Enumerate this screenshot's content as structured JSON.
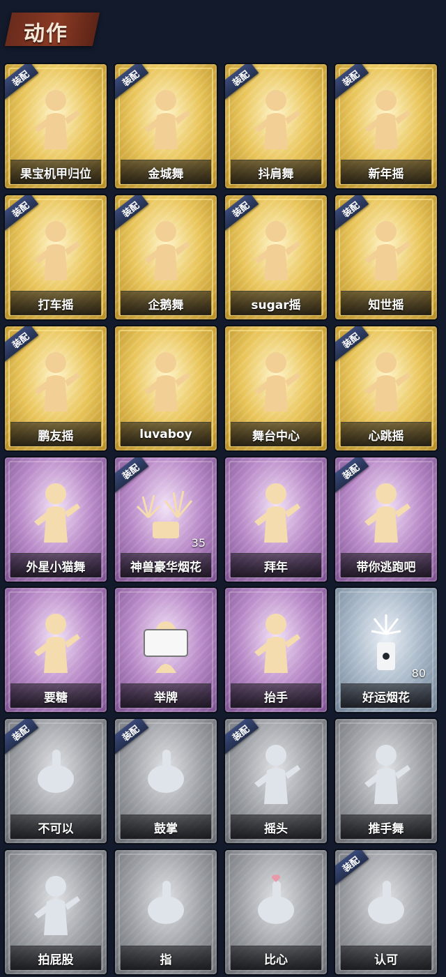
{
  "header": {
    "title": "动作"
  },
  "equip_label": "装配",
  "cards": [
    {
      "label": "果宝机甲归位",
      "tier": "gold",
      "equipped": true,
      "icon": "dancer-icon"
    },
    {
      "label": "金城舞",
      "tier": "gold",
      "equipped": true,
      "icon": "dancer-icon"
    },
    {
      "label": "抖肩舞",
      "tier": "gold",
      "equipped": true,
      "icon": "dancer-icon"
    },
    {
      "label": "新年摇",
      "tier": "gold",
      "equipped": true,
      "icon": "dancer-icon"
    },
    {
      "label": "打车摇",
      "tier": "gold",
      "equipped": true,
      "icon": "dancer-icon"
    },
    {
      "label": "企鹅舞",
      "tier": "gold",
      "equipped": true,
      "icon": "dancer-icon"
    },
    {
      "label": "sugar摇",
      "tier": "gold",
      "equipped": true,
      "icon": "dancer-icon"
    },
    {
      "label": "知世摇",
      "tier": "gold",
      "equipped": true,
      "icon": "dancer-icon"
    },
    {
      "label": "鹏友摇",
      "tier": "gold",
      "equipped": true,
      "icon": "dancer-icon"
    },
    {
      "label": "luvaboy",
      "tier": "gold",
      "equipped": false,
      "icon": "dancer-icon"
    },
    {
      "label": "舞台中心",
      "tier": "gold",
      "equipped": false,
      "icon": "dancer-icon"
    },
    {
      "label": "心跳摇",
      "tier": "gold",
      "equipped": true,
      "icon": "dancer-icon"
    },
    {
      "label": "外星小猫舞",
      "tier": "purple",
      "equipped": false,
      "icon": "dancer-icon"
    },
    {
      "label": "神兽豪华烟花",
      "tier": "purple",
      "equipped": true,
      "icon": "fireworks-icon",
      "count": "35"
    },
    {
      "label": "拜年",
      "tier": "purple",
      "equipped": false,
      "icon": "dancer-icon"
    },
    {
      "label": "带你逃跑吧",
      "tier": "purple",
      "equipped": true,
      "icon": "dancer-icon"
    },
    {
      "label": "要糖",
      "tier": "purple",
      "equipped": false,
      "icon": "dancer-icon"
    },
    {
      "label": "举牌",
      "tier": "purple",
      "equipped": false,
      "icon": "sign-icon"
    },
    {
      "label": "抬手",
      "tier": "purple",
      "equipped": false,
      "icon": "dancer-icon"
    },
    {
      "label": "好运烟花",
      "tier": "blue",
      "equipped": false,
      "icon": "firework-can-icon",
      "count": "80"
    },
    {
      "label": "不可以",
      "tier": "gray",
      "equipped": true,
      "icon": "finger-icon"
    },
    {
      "label": "鼓掌",
      "tier": "gray",
      "equipped": true,
      "icon": "clap-icon"
    },
    {
      "label": "摇头",
      "tier": "gray",
      "equipped": true,
      "icon": "dancer-icon"
    },
    {
      "label": "推手舞",
      "tier": "gray",
      "equipped": false,
      "icon": "dancer-icon"
    },
    {
      "label": "拍屁股",
      "tier": "gray",
      "equipped": false,
      "icon": "dancer-icon"
    },
    {
      "label": "指",
      "tier": "gray",
      "equipped": false,
      "icon": "point-hand-icon"
    },
    {
      "label": "比心",
      "tier": "gray",
      "equipped": false,
      "icon": "heart-hand-icon"
    },
    {
      "label": "认可",
      "tier": "gray",
      "equipped": true,
      "icon": "thumbs-up-icon"
    }
  ]
}
